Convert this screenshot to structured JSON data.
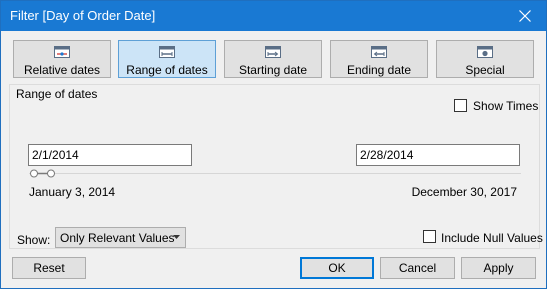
{
  "window": {
    "title": "Filter [Day of Order Date]",
    "title_bar_color": "#1979d3",
    "close_icon": "close-icon"
  },
  "modes": [
    {
      "label": "Relative dates",
      "icon": "relative-dates-icon",
      "active": false
    },
    {
      "label": "Range of dates",
      "icon": "range-of-dates-icon",
      "active": true
    },
    {
      "label": "Starting date",
      "icon": "starting-date-icon",
      "active": false
    },
    {
      "label": "Ending date",
      "icon": "ending-date-icon",
      "active": false
    },
    {
      "label": "Special",
      "icon": "special-icon",
      "active": false
    }
  ],
  "panel": {
    "label": "Range of dates",
    "show_times_label": "Show Times",
    "show_times_checked": false,
    "start_date": "2/1/2014",
    "end_date": "2/28/2014",
    "range_min_label": "January 3, 2014",
    "range_max_label": "December 30, 2017",
    "selected_range_fraction": [
      0.0199,
      0.0384
    ]
  },
  "footer": {
    "show_label": "Show:",
    "show_value": "Only Relevant Values",
    "include_null_label": "Include Null Values",
    "include_null_checked": false,
    "reset_label": "Reset",
    "ok_label": "OK",
    "cancel_label": "Cancel",
    "apply_label": "Apply"
  },
  "colors": {
    "active_mode_bg": "#cce4f7",
    "button_bg": "#e1e1e1",
    "default_button_border": "#0078d7"
  }
}
